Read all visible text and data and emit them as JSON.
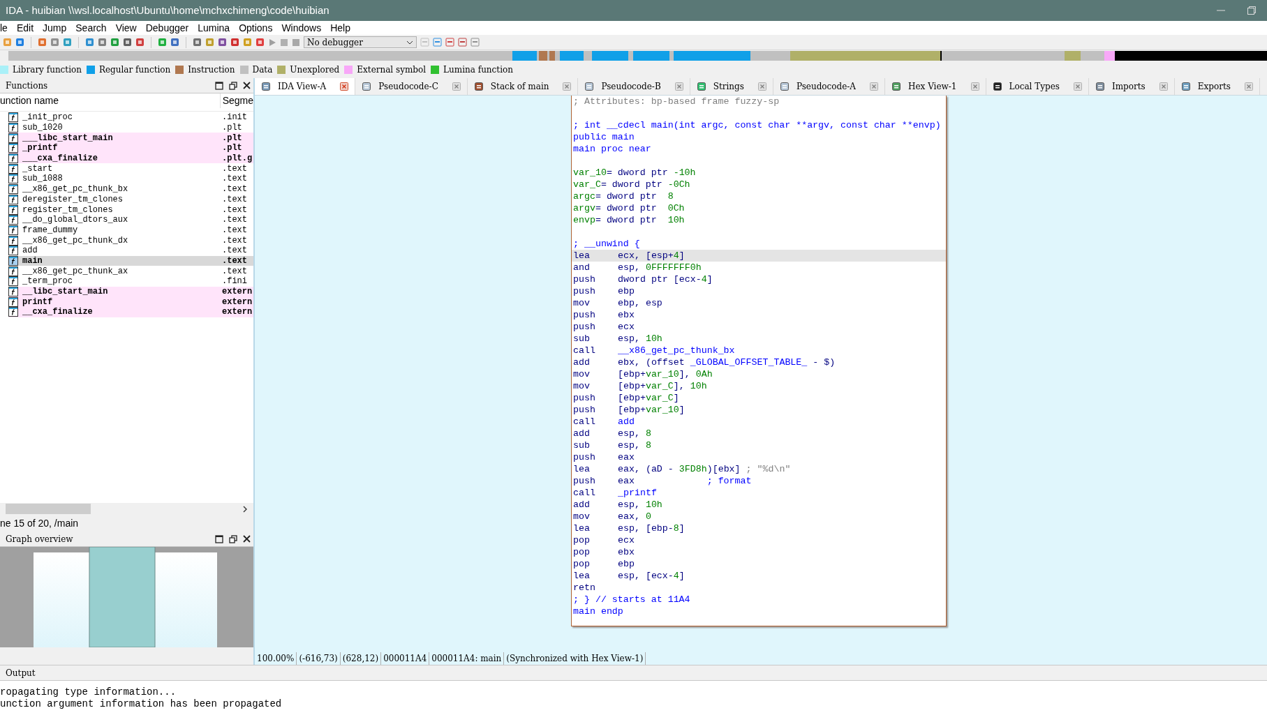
{
  "window": {
    "title": "IDA - huibian \\\\wsl.localhost\\Ubuntu\\home\\mchxchimeng\\code\\huibian"
  },
  "menu": [
    "le",
    "Edit",
    "Jump",
    "Search",
    "View",
    "Debugger",
    "Lumina",
    "Options",
    "Windows",
    "Help"
  ],
  "toolbar": {
    "debugger": "No debugger"
  },
  "legend": [
    {
      "label": "Library function",
      "color": "#aaf0f8"
    },
    {
      "label": "Regular function",
      "color": "#10a0e8"
    },
    {
      "label": "Instruction",
      "color": "#b07850"
    },
    {
      "label": "Data",
      "color": "#c0c0c0"
    },
    {
      "label": "Unexplored",
      "color": "#b0b068"
    },
    {
      "label": "External symbol",
      "color": "#f8a8f8"
    },
    {
      "label": "Lumina function",
      "color": "#30c030"
    }
  ],
  "functions": {
    "title": "Functions",
    "columns": [
      "unction name",
      "Segme"
    ],
    "rows": [
      {
        "name": "_init_proc",
        "segment": ".init",
        "kind": "regular",
        "selected": false
      },
      {
        "name": "sub_1020",
        "segment": ".plt",
        "kind": "regular",
        "selected": false
      },
      {
        "name": "___libc_start_main",
        "segment": ".plt",
        "kind": "external",
        "selected": false
      },
      {
        "name": "_printf",
        "segment": ".plt",
        "kind": "external",
        "selected": false
      },
      {
        "name": "___cxa_finalize",
        "segment": ".plt.g",
        "kind": "external",
        "selected": false
      },
      {
        "name": "_start",
        "segment": ".text",
        "kind": "regular",
        "selected": false
      },
      {
        "name": "sub_1088",
        "segment": ".text",
        "kind": "regular",
        "selected": false
      },
      {
        "name": "__x86_get_pc_thunk_bx",
        "segment": ".text",
        "kind": "regular",
        "selected": false
      },
      {
        "name": "deregister_tm_clones",
        "segment": ".text",
        "kind": "regular",
        "selected": false
      },
      {
        "name": "register_tm_clones",
        "segment": ".text",
        "kind": "regular",
        "selected": false
      },
      {
        "name": "__do_global_dtors_aux",
        "segment": ".text",
        "kind": "regular",
        "selected": false
      },
      {
        "name": "frame_dummy",
        "segment": ".text",
        "kind": "regular",
        "selected": false
      },
      {
        "name": "__x86_get_pc_thunk_dx",
        "segment": ".text",
        "kind": "regular",
        "selected": false
      },
      {
        "name": "add",
        "segment": ".text",
        "kind": "regular",
        "selected": false
      },
      {
        "name": "main",
        "segment": ".text",
        "kind": "regular",
        "selected": true
      },
      {
        "name": "__x86_get_pc_thunk_ax",
        "segment": ".text",
        "kind": "regular",
        "selected": false
      },
      {
        "name": "_term_proc",
        "segment": ".fini",
        "kind": "regular",
        "selected": false
      },
      {
        "name": "__libc_start_main",
        "segment": "extern",
        "kind": "external",
        "selected": false
      },
      {
        "name": "printf",
        "segment": "extern",
        "kind": "external",
        "selected": false
      },
      {
        "name": "__cxa_finalize",
        "segment": "extern",
        "kind": "external",
        "selected": false
      }
    ],
    "status": "ne 15 of 20, /main"
  },
  "graph_overview": {
    "title": "Graph overview"
  },
  "tabs": [
    {
      "label": "IDA View-A",
      "selected": true
    },
    {
      "label": "Pseudocode-C",
      "selected": false
    },
    {
      "label": "Stack of main",
      "selected": false
    },
    {
      "label": "Pseudocode-B",
      "selected": false
    },
    {
      "label": "Strings",
      "selected": false
    },
    {
      "label": "Pseudocode-A",
      "selected": false
    },
    {
      "label": "Hex View-1",
      "selected": false
    },
    {
      "label": "Local Types",
      "selected": false
    },
    {
      "label": "Imports",
      "selected": false
    },
    {
      "label": "Exports",
      "selected": false
    }
  ],
  "code": [
    {
      "selected": false,
      "tokens": [
        {
          "t": "; Attributes: bp-based frame fuzzy-sp",
          "kind": "comment"
        }
      ]
    },
    {
      "selected": false
    },
    {
      "selected": false,
      "tokens": [
        {
          "t": "; int __cdecl main(int argc, const char **argv, const char **envp)",
          "kind": "blue"
        }
      ]
    },
    {
      "selected": false,
      "tokens": [
        {
          "t": "public main",
          "kind": "blue"
        }
      ]
    },
    {
      "selected": false,
      "tokens": [
        {
          "t": "main proc near",
          "kind": "blue"
        }
      ]
    },
    {
      "selected": false
    },
    {
      "selected": false,
      "tokens": [
        {
          "t": "var_10",
          "kind": "green"
        },
        {
          "t": "= dword ptr ",
          "kind": "plain"
        },
        {
          "t": "-10h",
          "kind": "green"
        }
      ]
    },
    {
      "selected": false,
      "tokens": [
        {
          "t": "var_C",
          "kind": "green"
        },
        {
          "t": "= dword ptr ",
          "kind": "plain"
        },
        {
          "t": "-0Ch",
          "kind": "green"
        }
      ]
    },
    {
      "selected": false,
      "tokens": [
        {
          "t": "argc",
          "kind": "green"
        },
        {
          "t": "= dword ptr  ",
          "kind": "plain"
        },
        {
          "t": "8",
          "kind": "green"
        }
      ]
    },
    {
      "selected": false,
      "tokens": [
        {
          "t": "argv",
          "kind": "green"
        },
        {
          "t": "= dword ptr  ",
          "kind": "plain"
        },
        {
          "t": "0Ch",
          "kind": "green"
        }
      ]
    },
    {
      "selected": false,
      "tokens": [
        {
          "t": "envp",
          "kind": "green"
        },
        {
          "t": "= dword ptr  ",
          "kind": "plain"
        },
        {
          "t": "10h",
          "kind": "green"
        }
      ]
    },
    {
      "selected": false
    },
    {
      "selected": false,
      "tokens": [
        {
          "t": "; __unwind {",
          "kind": "blue"
        }
      ]
    },
    {
      "selected": true,
      "op": "lea",
      "tokens": [
        {
          "t": "ecx, [esp+",
          "kind": "plain"
        },
        {
          "t": "4",
          "kind": "green"
        },
        {
          "t": "]",
          "kind": "plain"
        }
      ]
    },
    {
      "selected": false,
      "op": "and",
      "tokens": [
        {
          "t": "esp, ",
          "kind": "plain"
        },
        {
          "t": "0FFFFFFF0h",
          "kind": "green"
        }
      ]
    },
    {
      "selected": false,
      "op": "push",
      "tokens": [
        {
          "t": "dword ptr [ecx-",
          "kind": "plain"
        },
        {
          "t": "4",
          "kind": "green"
        },
        {
          "t": "]",
          "kind": "plain"
        }
      ]
    },
    {
      "selected": false,
      "op": "push",
      "tokens": [
        {
          "t": "ebp",
          "kind": "plain"
        }
      ]
    },
    {
      "selected": false,
      "op": "mov",
      "tokens": [
        {
          "t": "ebp, esp",
          "kind": "plain"
        }
      ]
    },
    {
      "selected": false,
      "op": "push",
      "tokens": [
        {
          "t": "ebx",
          "kind": "plain"
        }
      ]
    },
    {
      "selected": false,
      "op": "push",
      "tokens": [
        {
          "t": "ecx",
          "kind": "plain"
        }
      ]
    },
    {
      "selected": false,
      "op": "sub",
      "tokens": [
        {
          "t": "esp, ",
          "kind": "plain"
        },
        {
          "t": "10h",
          "kind": "green"
        }
      ]
    },
    {
      "selected": false,
      "op": "call",
      "tokens": [
        {
          "t": "__x86_get_pc_thunk_bx",
          "kind": "blue"
        }
      ]
    },
    {
      "selected": false,
      "op": "add",
      "tokens": [
        {
          "t": "ebx, (offset ",
          "kind": "plain"
        },
        {
          "t": "_GLOBAL_OFFSET_TABLE_",
          "kind": "blue"
        },
        {
          "t": " - $)",
          "kind": "plain"
        }
      ]
    },
    {
      "selected": false,
      "op": "mov",
      "tokens": [
        {
          "t": "[ebp+",
          "kind": "plain"
        },
        {
          "t": "var_10",
          "kind": "green"
        },
        {
          "t": "], ",
          "kind": "plain"
        },
        {
          "t": "0Ah",
          "kind": "green"
        }
      ]
    },
    {
      "selected": false,
      "op": "mov",
      "tokens": [
        {
          "t": "[ebp+",
          "kind": "plain"
        },
        {
          "t": "var_C",
          "kind": "green"
        },
        {
          "t": "], ",
          "kind": "plain"
        },
        {
          "t": "10h",
          "kind": "green"
        }
      ]
    },
    {
      "selected": false,
      "op": "push",
      "tokens": [
        {
          "t": "[ebp+",
          "kind": "plain"
        },
        {
          "t": "var_C",
          "kind": "green"
        },
        {
          "t": "]",
          "kind": "plain"
        }
      ]
    },
    {
      "selected": false,
      "op": "push",
      "tokens": [
        {
          "t": "[ebp+",
          "kind": "plain"
        },
        {
          "t": "var_10",
          "kind": "green"
        },
        {
          "t": "]",
          "kind": "plain"
        }
      ]
    },
    {
      "selected": false,
      "op": "call",
      "tokens": [
        {
          "t": "add",
          "kind": "blue"
        }
      ]
    },
    {
      "selected": false,
      "op": "add",
      "tokens": [
        {
          "t": "esp, ",
          "kind": "plain"
        },
        {
          "t": "8",
          "kind": "green"
        }
      ]
    },
    {
      "selected": false,
      "op": "sub",
      "tokens": [
        {
          "t": "esp, ",
          "kind": "plain"
        },
        {
          "t": "8",
          "kind": "green"
        }
      ]
    },
    {
      "selected": false,
      "op": "push",
      "tokens": [
        {
          "t": "eax",
          "kind": "plain"
        }
      ]
    },
    {
      "selected": false,
      "op": "lea",
      "tokens": [
        {
          "t": "eax, (aD - ",
          "kind": "plain"
        },
        {
          "t": "3FD8h",
          "kind": "green"
        },
        {
          "t": ")[ebx] ",
          "kind": "plain"
        },
        {
          "t": "; \"%d\\n\"",
          "kind": "comment"
        }
      ]
    },
    {
      "selected": false,
      "op": "push",
      "tokens": [
        {
          "t": "eax             ",
          "kind": "plain"
        },
        {
          "t": "; format",
          "kind": "blue"
        }
      ]
    },
    {
      "selected": false,
      "op": "call",
      "tokens": [
        {
          "t": "_printf",
          "kind": "blue"
        }
      ]
    },
    {
      "selected": false,
      "op": "add",
      "tokens": [
        {
          "t": "esp, ",
          "kind": "plain"
        },
        {
          "t": "10h",
          "kind": "green"
        }
      ]
    },
    {
      "selected": false,
      "op": "mov",
      "tokens": [
        {
          "t": "eax, ",
          "kind": "plain"
        },
        {
          "t": "0",
          "kind": "green"
        }
      ]
    },
    {
      "selected": false,
      "op": "lea",
      "tokens": [
        {
          "t": "esp, [ebp-",
          "kind": "plain"
        },
        {
          "t": "8",
          "kind": "green"
        },
        {
          "t": "]",
          "kind": "plain"
        }
      ]
    },
    {
      "selected": false,
      "op": "pop",
      "tokens": [
        {
          "t": "ecx",
          "kind": "plain"
        }
      ]
    },
    {
      "selected": false,
      "op": "pop",
      "tokens": [
        {
          "t": "ebx",
          "kind": "plain"
        }
      ]
    },
    {
      "selected": false,
      "op": "pop",
      "tokens": [
        {
          "t": "ebp",
          "kind": "plain"
        }
      ]
    },
    {
      "selected": false,
      "op": "lea",
      "tokens": [
        {
          "t": "esp, [ecx-",
          "kind": "plain"
        },
        {
          "t": "4",
          "kind": "green"
        },
        {
          "t": "]",
          "kind": "plain"
        }
      ]
    },
    {
      "selected": false,
      "op": "retn"
    },
    {
      "selected": false,
      "tokens": [
        {
          "t": "; } // starts at 11A4",
          "kind": "blue"
        }
      ]
    },
    {
      "selected": false,
      "tokens": [
        {
          "t": "main endp",
          "kind": "blue"
        }
      ]
    }
  ],
  "status_bar": [
    "100.00%",
    "(-616,73)",
    "(628,12)",
    "000011A4",
    "000011A4: main",
    "(Synchronized with Hex View-1)"
  ],
  "output": {
    "title": "Output",
    "lines": [
      "ropagating type information...",
      "unction argument information has been propagated"
    ]
  }
}
